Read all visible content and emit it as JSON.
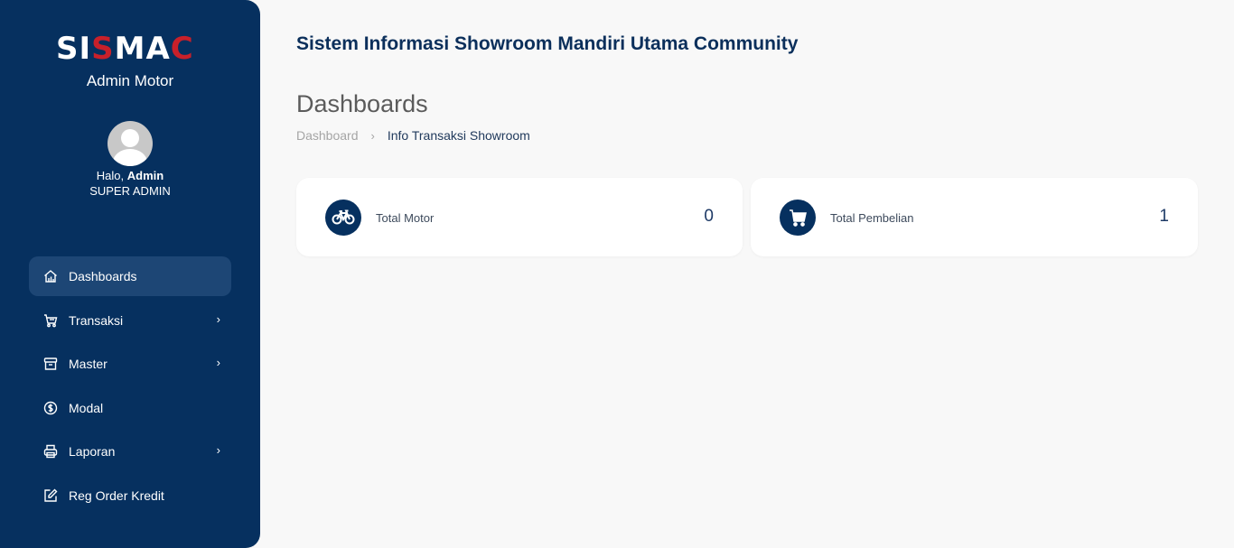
{
  "brand": {
    "logo_part1": "SI",
    "logo_part2": "S",
    "logo_part3": "MA",
    "logo_part4": "C",
    "subtitle": "Admin Motor"
  },
  "user": {
    "greeting": "Halo,",
    "name": "Admin",
    "role": "SUPER ADMIN"
  },
  "sidebar": {
    "items": [
      {
        "label": "Dashboards",
        "icon": "home-chart-icon",
        "active": true
      },
      {
        "label": "Transaksi",
        "icon": "cart-icon",
        "has_submenu": true
      },
      {
        "label": "Master",
        "icon": "archive-icon",
        "has_submenu": true
      },
      {
        "label": "Modal",
        "icon": "dollar-circle-icon"
      },
      {
        "label": "Laporan",
        "icon": "printer-icon",
        "has_submenu": true
      },
      {
        "label": "Reg Order Kredit",
        "icon": "edit-icon"
      }
    ],
    "chevron": "›"
  },
  "header": {
    "title": "Sistem Informasi Showroom Mandiri Utama Community"
  },
  "page": {
    "title": "Dashboards",
    "breadcrumb": {
      "home": "Dashboard",
      "separator": "›",
      "current": "Info Transaksi Showroom"
    }
  },
  "stats": [
    {
      "label": "Total Motor",
      "value": "0",
      "icon": "bicycle-icon"
    },
    {
      "label": "Total Pembelian",
      "value": "1",
      "icon": "shopping-cart-icon"
    }
  ],
  "colors": {
    "sidebar_bg": "#06305f",
    "active_item_bg": "#1d4675",
    "logo_accent": "#c8202a",
    "page_bg": "#f8f8f8"
  }
}
